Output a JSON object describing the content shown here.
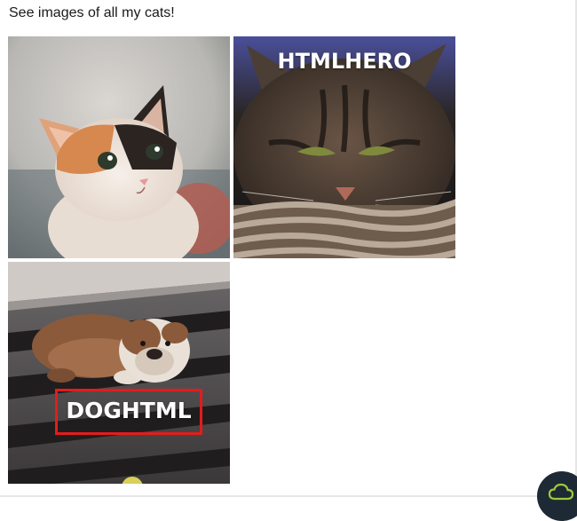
{
  "intro_text": "See images of all my cats!",
  "gallery": {
    "images": [
      {
        "name": "kitten",
        "caption": ""
      },
      {
        "name": "tabby-cat",
        "caption": "HTMLHERO"
      },
      {
        "name": "bulldog",
        "caption": "DOGHTML"
      }
    ]
  },
  "colors": {
    "caption_box_border": "#e31c1c",
    "caption_text": "#ffffff",
    "floating_button_bg": "#1d2a35",
    "cloud_icon": "#9bc93a"
  },
  "floating_button": {
    "icon": "cloud-icon"
  }
}
